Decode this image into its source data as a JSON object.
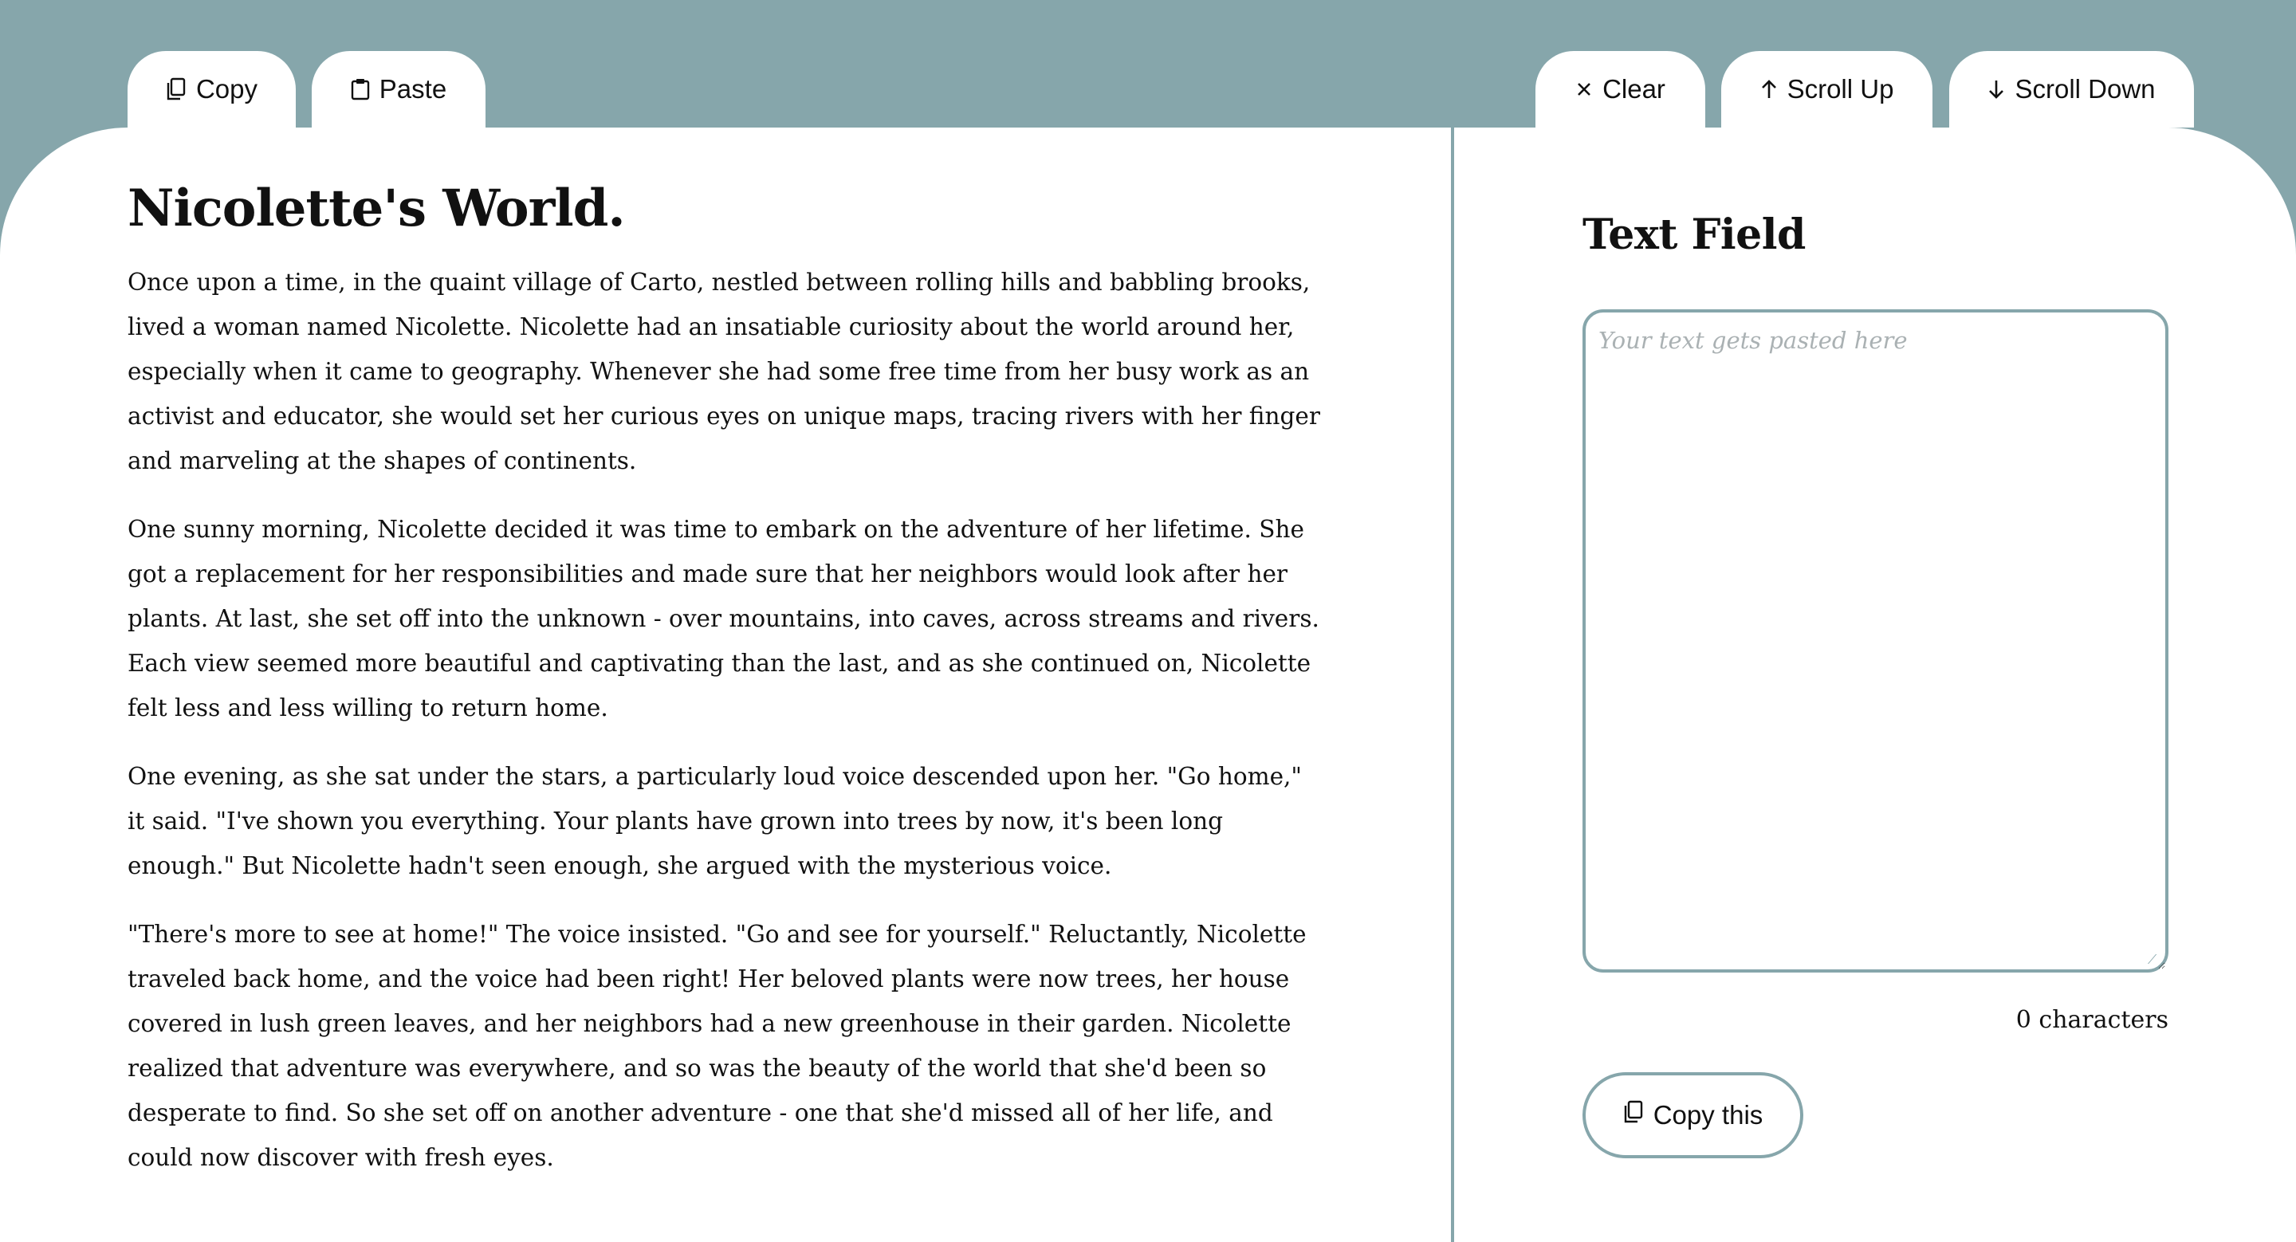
{
  "toolbar": {
    "copy_label": "Copy",
    "paste_label": "Paste",
    "clear_label": "Clear",
    "scroll_up_label": "Scroll Up",
    "scroll_down_label": "Scroll Down"
  },
  "icons": {
    "copy": "copy-icon",
    "paste": "clipboard-icon",
    "clear": "close-icon",
    "scroll_up": "arrow-up-icon",
    "scroll_down": "arrow-down-icon"
  },
  "story": {
    "title": "Nicolette's World.",
    "paragraphs": [
      "Once upon a time, in the quaint village of Carto, nestled between rolling hills and babbling brooks, lived a woman named Nicolette. Nicolette had an insatiable curiosity about the world around her, especially when it came to geography. Whenever she had some free time from her busy work as an activist and educator, she would set her curious eyes on unique maps, tracing rivers with her finger and marveling at the shapes of continents.",
      "One sunny morning, Nicolette decided it was time to embark on the adventure of her lifetime. She got a replacement for her responsibilities and made sure that her neighbors would look after her plants. At last, she set off into the unknown - over mountains, into caves, across streams and rivers. Each view seemed more beautiful and captivating than the last, and as she continued on, Nicolette felt less and less willing to return home.",
      "One evening, as she sat under the stars, a particularly loud voice descended upon her. \"Go home,\" it said. \"I've shown you everything. Your plants have grown into trees by now, it's been long enough.\" But Nicolette hadn't seen enough, she argued with the mysterious voice.",
      "\"There's more to see at home!\" The voice insisted. \"Go and see for yourself.\" Reluctantly, Nicolette traveled back home, and the voice had been right! Her beloved plants were now trees, her house covered in lush green leaves, and her neighbors had a new greenhouse in their garden. Nicolette realized that adventure was everywhere, and so was the beauty of the world that she'd been so desperate to find. So she set off on another adventure - one that she'd missed all of her life, and could now discover with fresh eyes."
    ]
  },
  "panel": {
    "title": "Text Field",
    "placeholder": "Your text gets pasted here",
    "value": "",
    "char_count": "0 characters",
    "copy_this_label": "Copy this"
  },
  "colors": {
    "accent": "#86a6ab",
    "background": "#ffffff",
    "text": "#111111"
  }
}
